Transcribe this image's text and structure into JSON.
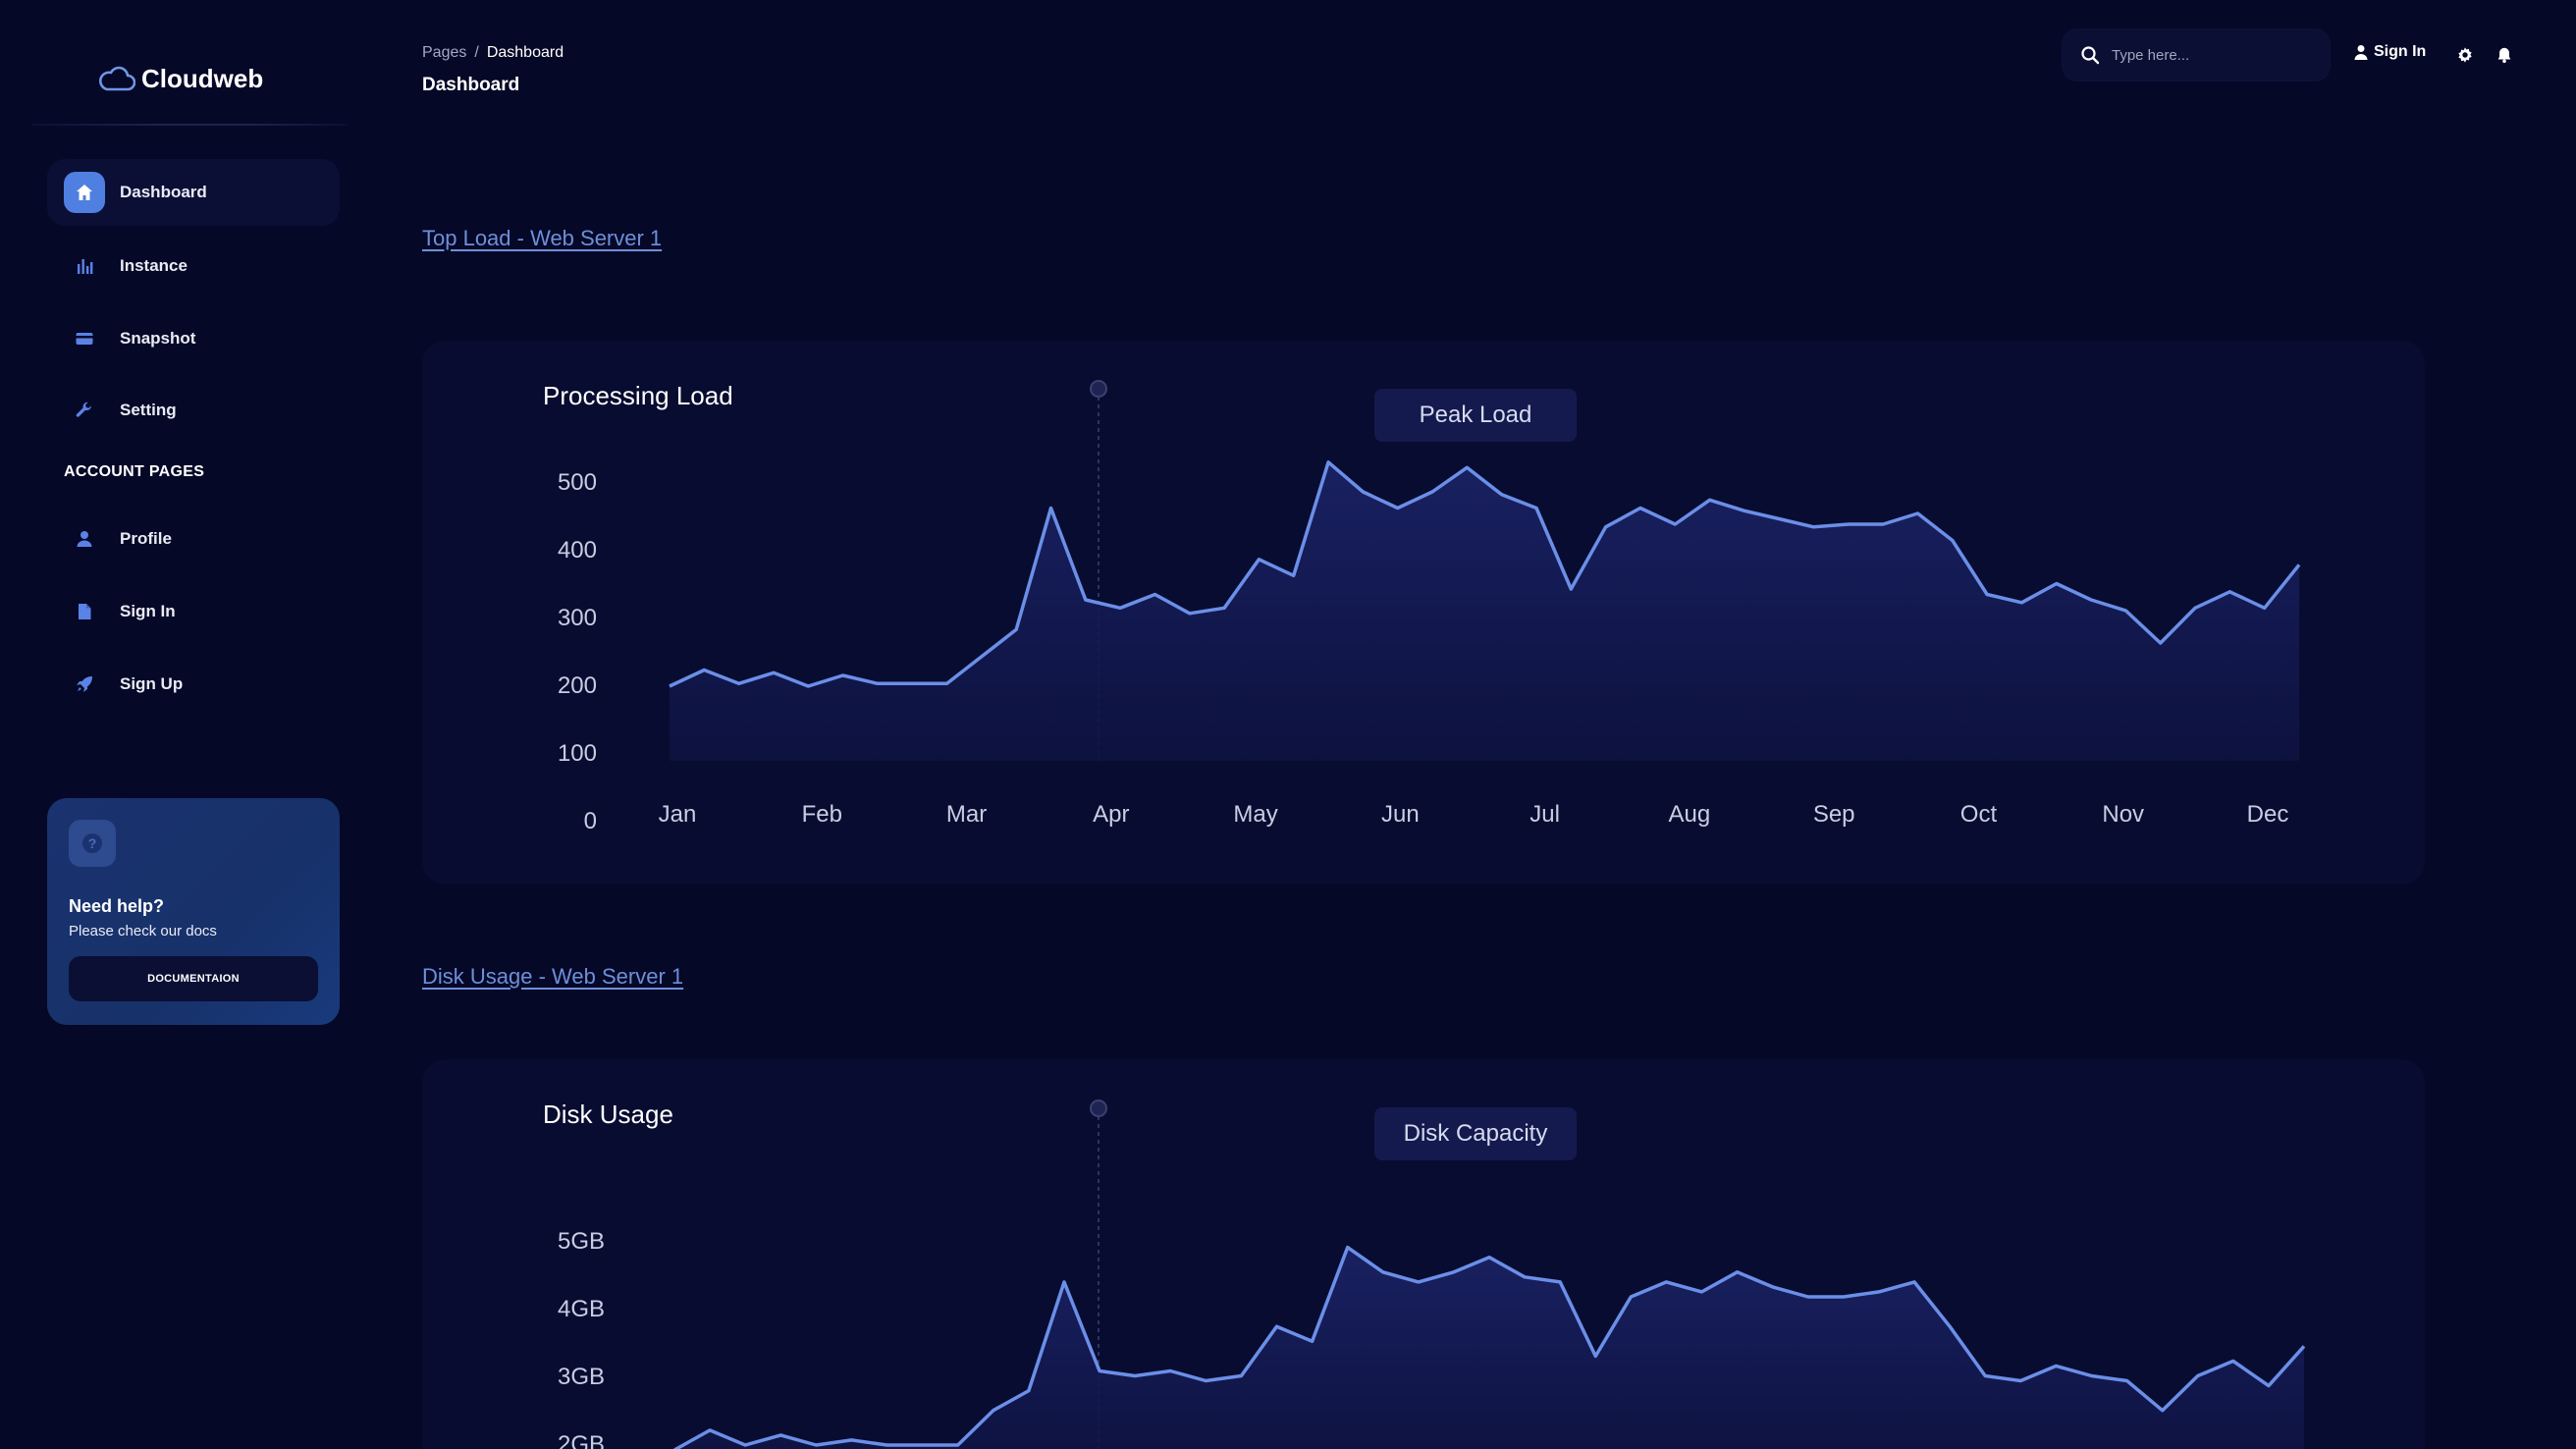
{
  "brand": {
    "name": "Cloudweb"
  },
  "sidebar": {
    "items": [
      {
        "label": "Dashboard",
        "icon": "home-icon",
        "active": true
      },
      {
        "label": "Instance",
        "icon": "bar-chart-icon",
        "active": false
      },
      {
        "label": "Snapshot",
        "icon": "credit-card-icon",
        "active": false
      },
      {
        "label": "Setting",
        "icon": "wrench-icon",
        "active": false
      }
    ],
    "section_title": "ACCOUNT PAGES",
    "account_items": [
      {
        "label": "Profile",
        "icon": "person-icon"
      },
      {
        "label": "Sign In",
        "icon": "document-icon"
      },
      {
        "label": "Sign Up",
        "icon": "rocket-icon"
      }
    ],
    "help": {
      "title": "Need help?",
      "subtitle": "Please check our docs",
      "button": "DOCUMENTAION",
      "icon": "question-icon"
    }
  },
  "header": {
    "breadcrumb_root": "Pages",
    "breadcrumb_sep": "/",
    "breadcrumb_current": "Dashboard",
    "title": "Dashboard",
    "search_placeholder": "Type here...",
    "signin_label": "Sign In"
  },
  "colors": {
    "background": "#050827",
    "card": "#080c30",
    "line": "#6b8fe8",
    "accent": "#4f7fe0",
    "link": "#6e8fd9"
  },
  "sections": {
    "load_link": "Top Load - Web Server 1",
    "disk_link": "Disk Usage - Web Server 1"
  },
  "chart_data": [
    {
      "type": "area",
      "title": "Processing Load",
      "legend": "Peak Load",
      "categories": [
        "Jan",
        "Feb",
        "Mar",
        "Apr",
        "May",
        "Jun",
        "Jul",
        "Aug",
        "Sep",
        "Oct",
        "Nov",
        "Dec"
      ],
      "y_ticks": [
        "500",
        "400",
        "300",
        "200",
        "100",
        "0"
      ],
      "ylim": [
        0,
        500
      ],
      "series": [
        {
          "values": [
            120,
            150,
            125,
            145,
            120,
            140,
            125,
            125,
            125,
            175,
            225,
            450,
            280,
            265,
            290,
            255,
            265,
            355,
            325,
            535,
            480,
            450,
            480,
            525,
            475,
            450,
            300,
            415,
            450,
            420,
            465,
            445,
            430,
            415,
            420,
            420,
            440,
            390,
            290,
            275,
            310,
            280,
            260,
            200,
            265,
            295,
            265,
            345
          ]
        }
      ]
    },
    {
      "type": "area",
      "title": "Disk Usage",
      "legend": "Disk Capacity",
      "categories": [
        "Jan",
        "Feb",
        "Mar",
        "Apr",
        "May",
        "Jun",
        "Jul",
        "Aug",
        "Sep",
        "Oct",
        "Nov",
        "Dec"
      ],
      "y_ticks": [
        "5GB",
        "4GB",
        "3GB",
        "2GB"
      ],
      "ylim": [
        2,
        5
      ],
      "series": [
        {
          "values": [
            2.0,
            2.2,
            2.05,
            2.15,
            2.05,
            2.1,
            2.05,
            2.05,
            2.05,
            2.4,
            2.6,
            3.7,
            2.8,
            2.75,
            2.8,
            2.7,
            2.75,
            3.25,
            3.1,
            4.05,
            3.8,
            3.7,
            3.8,
            3.95,
            3.75,
            3.7,
            2.95,
            3.55,
            3.7,
            3.6,
            3.8,
            3.65,
            3.55,
            3.55,
            3.6,
            3.7,
            3.25,
            2.75,
            2.7,
            2.85,
            2.75,
            2.7,
            2.4,
            2.75,
            2.9,
            2.65,
            3.05
          ]
        }
      ]
    }
  ]
}
